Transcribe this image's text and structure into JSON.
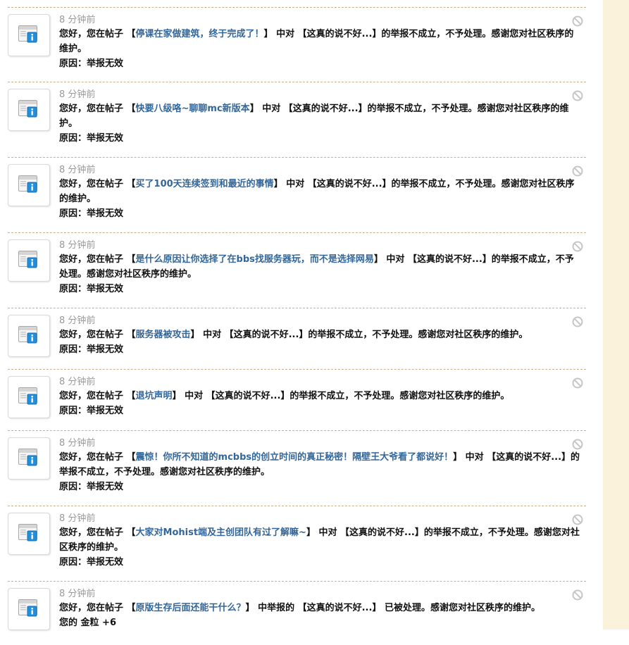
{
  "notices": [
    {
      "time": "8 分钟前",
      "prefix": "您好，您在帖子 【",
      "thread": "停课在家做建筑，终于完成了！",
      "mid": "】 中对 【这真的说不好...】的举报不成立，不予处理。感谢您对社区秩序的维护。",
      "reason": "原因：举报无效"
    },
    {
      "time": "8 分钟前",
      "prefix": "您好，您在帖子 【",
      "thread": "快要八级咯~聊聊mc新版本",
      "mid": "】 中对 【这真的说不好...】的举报不成立，不予处理。感谢您对社区秩序的维护。",
      "reason": "原因：举报无效"
    },
    {
      "time": "8 分钟前",
      "prefix": "您好，您在帖子 【",
      "thread": "买了100天连续签到和最近的事情",
      "mid": "】 中对 【这真的说不好...】的举报不成立，不予处理。感谢您对社区秩序的维护。",
      "reason": "原因：举报无效"
    },
    {
      "time": "8 分钟前",
      "prefix": "您好，您在帖子 【",
      "thread": "是什么原因让你选择了在bbs找服务器玩，而不是选择网易",
      "mid": "】 中对 【这真的说不好...】的举报不成立，不予处理。感谢您对社区秩序的维护。",
      "reason": "原因：举报无效"
    },
    {
      "time": "8 分钟前",
      "prefix": "您好，您在帖子 【",
      "thread": "服务器被攻击",
      "mid": "】 中对 【这真的说不好...】的举报不成立，不予处理。感谢您对社区秩序的维护。",
      "reason": "原因：举报无效"
    },
    {
      "time": "8 分钟前",
      "prefix": "您好，您在帖子 【",
      "thread": "退坑声明",
      "mid": "】 中对 【这真的说不好...】的举报不成立，不予处理。感谢您对社区秩序的维护。",
      "reason": "原因：举报无效"
    },
    {
      "time": "8 分钟前",
      "prefix": "您好，您在帖子 【",
      "thread": "震惊！你所不知道的mcbbs的创立时间的真正秘密！隔壁王大爷看了都说好！",
      "mid": "】 中对 【这真的说不好...】的举报不成立，不予处理。感谢您对社区秩序的维护。",
      "reason": "原因：举报无效"
    },
    {
      "time": "8 分钟前",
      "prefix": "您好，您在帖子 【",
      "thread": "大家对Mohist端及主创团队有过了解嘛~",
      "mid": "】 中对 【这真的说不好...】的举报不成立，不予处理。感谢您对社区秩序的维护。",
      "reason": "原因：举报无效"
    },
    {
      "time": "8 分钟前",
      "prefix": "您好，您在帖子 【",
      "thread": "原版生存后面还能干什么？",
      "mid": "】 中举报的 【这真的说不好...】 已被处理。感谢您对社区秩序的维护。",
      "reason": "您的 金粒 +6"
    }
  ]
}
